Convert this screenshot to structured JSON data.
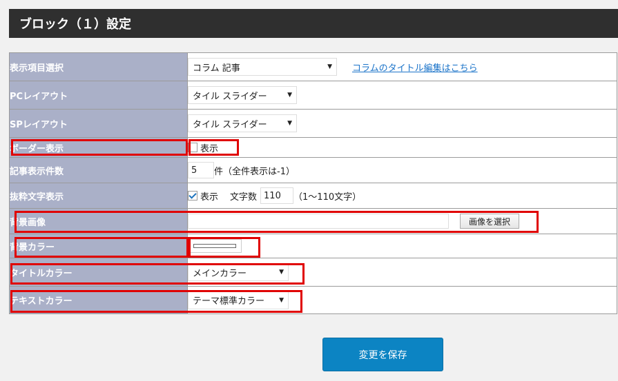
{
  "header": {
    "title": "ブロック（１）設定"
  },
  "rows": {
    "display_item": {
      "label": "表示項目選択",
      "select_value": "コラム 記事",
      "link": "コラムのタイトル編集はこちら"
    },
    "pc_layout": {
      "label": "PCレイアウト",
      "select_value": "タイル スライダー"
    },
    "sp_layout": {
      "label": "SPレイアウト",
      "select_value": "タイル スライダー"
    },
    "border_display": {
      "label": "ボーダー表示",
      "checkbox_label": "表示",
      "checked": false
    },
    "article_count": {
      "label": "記事表示件数",
      "value": "5",
      "suffix": "件（全件表示は-1）"
    },
    "excerpt": {
      "label": "抜粋文字表示",
      "checkbox_label": "表示",
      "checked": true,
      "chars_label": "文字数",
      "chars_value": "110",
      "chars_note": "（1〜110文字）"
    },
    "bg_image": {
      "label": "背景画像",
      "value": "",
      "button": "画像を選択"
    },
    "bg_color": {
      "label": "背景カラー",
      "value": "#ffffff"
    },
    "title_color": {
      "label": "タイトルカラー",
      "select_value": "メインカラー"
    },
    "text_color": {
      "label": "テキストカラー",
      "select_value": "テーマ標準カラー"
    }
  },
  "save_button": "変更を保存",
  "colors": {
    "header_bg": "#2f2f2f",
    "label_bg": "#aab0c8",
    "highlight": "#e00000",
    "save_bg": "#0c84c3",
    "link": "#1a73c9"
  }
}
